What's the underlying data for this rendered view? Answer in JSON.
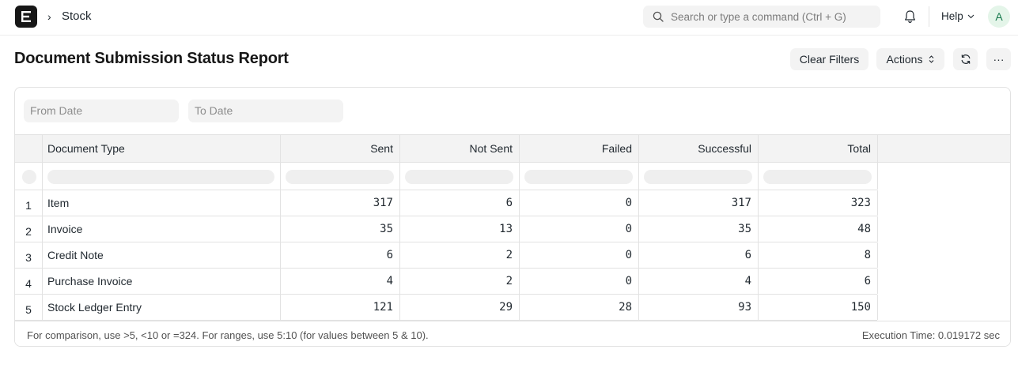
{
  "navbar": {
    "breadcrumb": "Stock",
    "breadcrumb_separator": "›",
    "search_placeholder": "Search or type a command (Ctrl + G)",
    "help_label": "Help",
    "avatar_initial": "A",
    "icons": {
      "logo": "erpnext-logo-icon",
      "search": "search-icon",
      "bell": "bell-icon",
      "help_chevron": "chevron-down-icon"
    }
  },
  "page": {
    "title": "Document Submission Status Report",
    "buttons": {
      "clear_filters": "Clear Filters",
      "actions": "Actions",
      "refresh_icon": "refresh-icon",
      "more": "···"
    }
  },
  "filters": {
    "from_date_placeholder": "From Date",
    "to_date_placeholder": "To Date"
  },
  "table": {
    "columns": [
      "Document Type",
      "Sent",
      "Not Sent",
      "Failed",
      "Successful",
      "Total"
    ],
    "rows": [
      {
        "index": "1",
        "document_type": "Item",
        "sent": "317",
        "not_sent": "6",
        "failed": "0",
        "successful": "317",
        "total": "323"
      },
      {
        "index": "2",
        "document_type": "Invoice",
        "sent": "35",
        "not_sent": "13",
        "failed": "0",
        "successful": "35",
        "total": "48"
      },
      {
        "index": "3",
        "document_type": "Credit Note",
        "sent": "6",
        "not_sent": "2",
        "failed": "0",
        "successful": "6",
        "total": "8"
      },
      {
        "index": "4",
        "document_type": "Purchase Invoice",
        "sent": "4",
        "not_sent": "2",
        "failed": "0",
        "successful": "4",
        "total": "6"
      },
      {
        "index": "5",
        "document_type": "Stock Ledger Entry",
        "sent": "121",
        "not_sent": "29",
        "failed": "28",
        "successful": "93",
        "total": "150"
      }
    ]
  },
  "footer": {
    "hint": "For comparison, use >5, <10 or =324. For ranges, use 5:10 (for values between 5 & 10).",
    "execution_time": "Execution Time: 0.019172 sec"
  },
  "colors": {
    "accent_avatar_bg": "#e4f5e9",
    "accent_avatar_fg": "#16794c",
    "logo_bg": "#171717"
  }
}
